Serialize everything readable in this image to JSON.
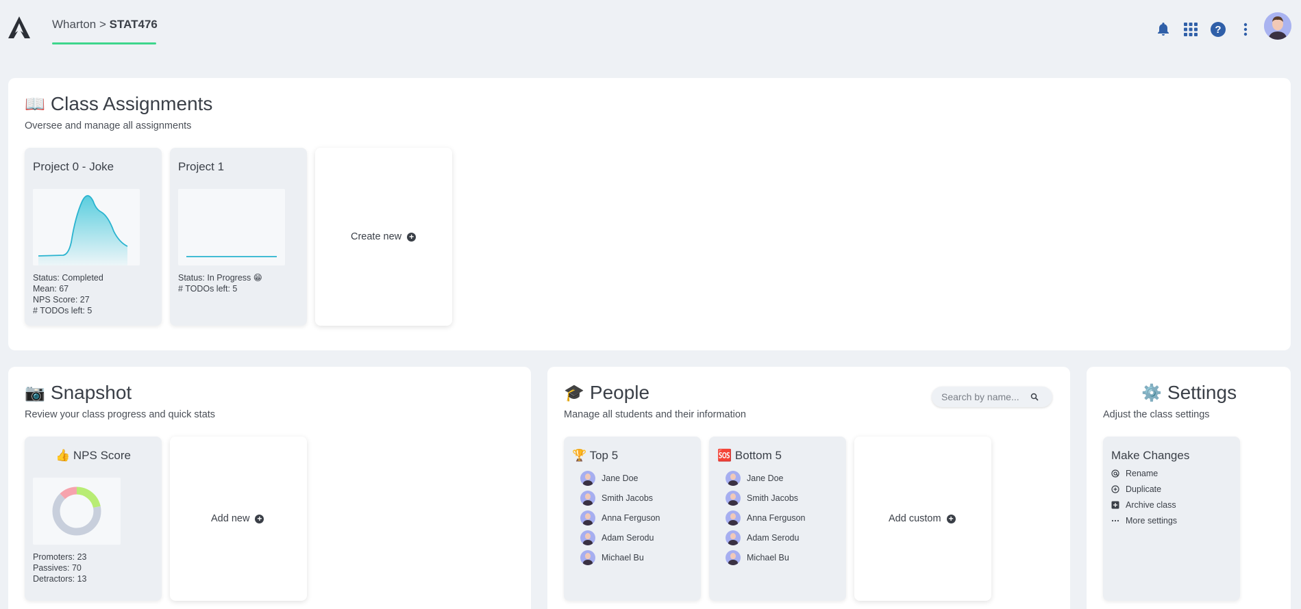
{
  "header": {
    "breadcrumb_org": "Wharton",
    "breadcrumb_sep": ">",
    "breadcrumb_class": "STAT476",
    "icons": [
      "bell-icon",
      "apps-grid-icon",
      "help-icon",
      "more-vert-icon"
    ],
    "accent_color": "#3dd68c",
    "icon_color": "#2f5fa8"
  },
  "assignments": {
    "emoji": "📖",
    "title": "Class Assignments",
    "subtitle": "Oversee and manage all assignments",
    "cards": [
      {
        "title": "Project 0 - Joke",
        "lines": [
          "Status: Completed",
          "Mean: 67",
          "NPS Score: 27",
          "# TODOs left: 5"
        ]
      },
      {
        "title": "Project 1",
        "lines": [
          "Status: In Progress 😁",
          "# TODOs left: 5"
        ]
      }
    ],
    "create_label": "Create new"
  },
  "snapshot": {
    "emoji": "📷",
    "title": "Snapshot",
    "subtitle": "Review your class progress and quick stats",
    "nps_emoji": "👍",
    "nps_title": "NPS Score",
    "nps_lines": [
      "Promoters: 23",
      "Passives: 70",
      "Detractors: 13"
    ],
    "nps_chart": {
      "promoters": 23,
      "passives": 70,
      "detractors": 13,
      "colors": {
        "promoters": "#b8ec74",
        "passives": "#c8cfdc",
        "detractors": "#f6a3ad"
      }
    },
    "add_label": "Add new"
  },
  "people": {
    "emoji": "🎓",
    "title": "People",
    "subtitle": "Manage all students and their information",
    "search_placeholder": "Search by name...",
    "top_emoji": "🏆",
    "top_title": "Top 5",
    "top": [
      "Jane Doe",
      "Smith Jacobs",
      "Anna Ferguson",
      "Adam Serodu",
      "Michael Bu"
    ],
    "bottom_emoji": "🆘",
    "bottom_title": "Bottom 5",
    "bottom": [
      "Jane Doe",
      "Smith Jacobs",
      "Anna Ferguson",
      "Adam Serodu",
      "Michael Bu"
    ],
    "add_label": "Add custom"
  },
  "settings": {
    "emoji": "⚙️",
    "title": "Settings",
    "subtitle": "Adjust the class settings",
    "card_title": "Make Changes",
    "actions": [
      {
        "icon": "at-icon",
        "label": "Rename"
      },
      {
        "icon": "duplicate-icon",
        "label": "Duplicate"
      },
      {
        "icon": "archive-icon",
        "label": "Archive class"
      },
      {
        "icon": "ellipsis-icon",
        "label": "More settings"
      }
    ]
  }
}
